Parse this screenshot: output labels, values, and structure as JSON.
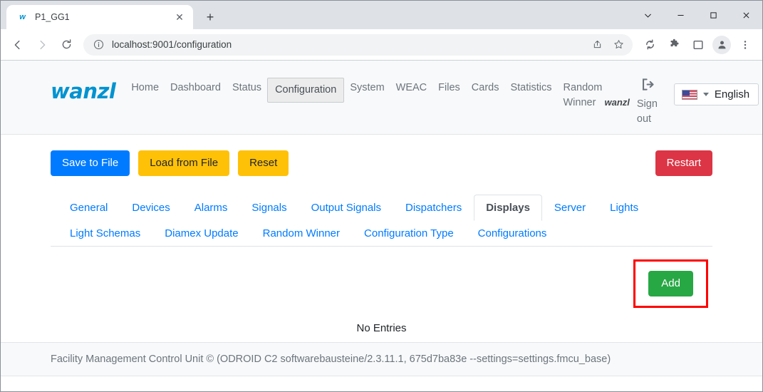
{
  "browser": {
    "tab": {
      "title": "P1_GG1",
      "favicon": "wanzl-favicon",
      "close_label": "✕"
    },
    "new_tab_label": "+",
    "window_controls": {
      "chevron": "chevron-down",
      "minimize": "—",
      "maximize": "□",
      "close": "✕"
    },
    "nav": {
      "back": "back-arrow",
      "forward": "forward-arrow",
      "reload": "reload-arrow"
    },
    "omnibox": {
      "url": "localhost:9001/configuration",
      "info_icon": "info-circle-icon"
    },
    "actions": [
      "share-icon",
      "bookmark-star-icon",
      "sync-icon",
      "extensions-puzzle-icon",
      "side-panel-icon",
      "profile-avatar-icon",
      "kebab-menu-icon"
    ]
  },
  "navbar": {
    "brand": "wanzl",
    "links": [
      {
        "label": "Home",
        "active": false
      },
      {
        "label": "Dashboard",
        "active": false
      },
      {
        "label": "Status",
        "active": false
      },
      {
        "label": "Configuration",
        "active": true
      },
      {
        "label": "System",
        "active": false
      },
      {
        "label": "WEAC",
        "active": false
      },
      {
        "label": "Files",
        "active": false
      },
      {
        "label": "Cards",
        "active": false
      },
      {
        "label": "Statistics",
        "active": false
      },
      {
        "label": "Random Winner",
        "active": false
      }
    ],
    "username": "wanzl",
    "signout_label": "Sign out",
    "signout_icon": "sign-out-icon",
    "language": {
      "value": "English",
      "flag": "us-flag-icon"
    }
  },
  "toolbar": {
    "save_label": "Save to File",
    "load_label": "Load from File",
    "reset_label": "Reset",
    "restart_label": "Restart"
  },
  "tabs": {
    "row1": [
      {
        "label": "General",
        "active": false
      },
      {
        "label": "Devices",
        "active": false
      },
      {
        "label": "Alarms",
        "active": false
      },
      {
        "label": "Signals",
        "active": false
      },
      {
        "label": "Output Signals",
        "active": false
      },
      {
        "label": "Dispatchers",
        "active": false
      },
      {
        "label": "Displays",
        "active": true
      },
      {
        "label": "Server",
        "active": false
      },
      {
        "label": "Lights",
        "active": false
      },
      {
        "label": "Light Schemas",
        "active": false
      }
    ],
    "row2": [
      {
        "label": "Diamex Update",
        "active": false
      },
      {
        "label": "Random Winner",
        "active": false
      },
      {
        "label": "Configuration Type",
        "active": false
      },
      {
        "label": "Configurations",
        "active": false
      }
    ]
  },
  "panel": {
    "add_label": "Add",
    "empty_label": "No Entries"
  },
  "footer": {
    "text": "Facility Management Control Unit © (ODROID C2 softwarebausteine/2.3.11.1, 675d7ba83e --settings=settings.fmcu_base)"
  },
  "colors": {
    "brand": "#0093d0",
    "primary": "#007bff",
    "warning": "#ffc107",
    "danger": "#dc3545",
    "success": "#28a745",
    "highlight": "#ff0000"
  }
}
